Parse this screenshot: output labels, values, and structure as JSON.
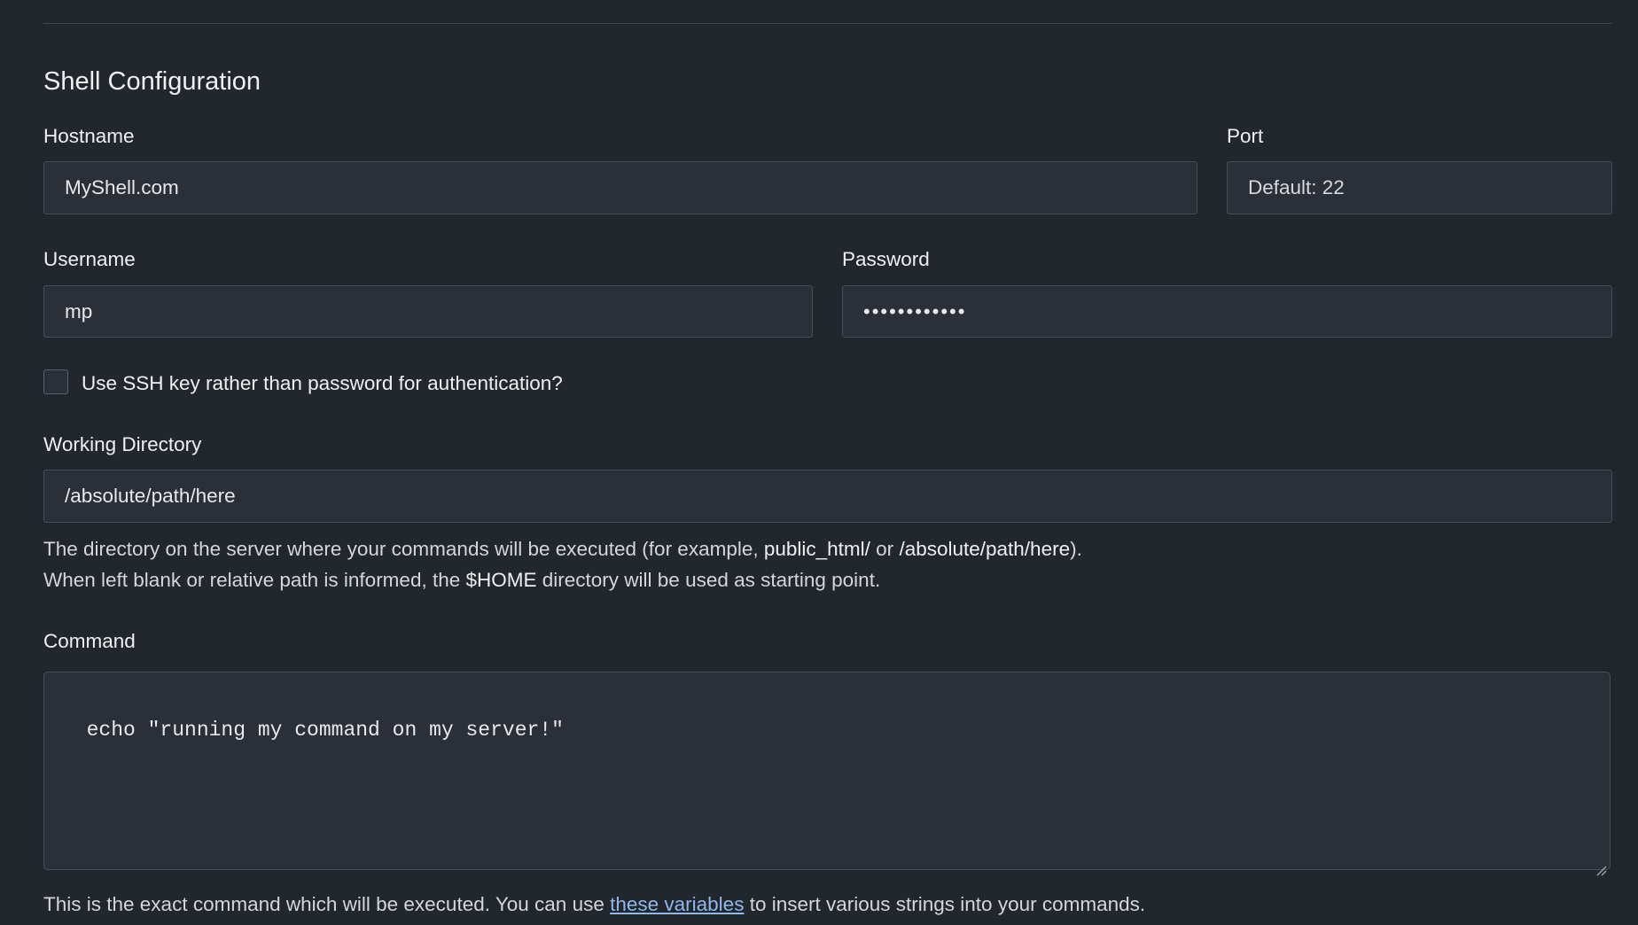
{
  "section": {
    "title": "Shell Configuration"
  },
  "hostname": {
    "label": "Hostname",
    "value": "MyShell.com"
  },
  "port": {
    "label": "Port",
    "placeholder": "Default: 22"
  },
  "username": {
    "label": "Username",
    "value": "mp"
  },
  "password": {
    "label": "Password",
    "masked_value": "••••••••••••"
  },
  "ssh_key": {
    "label": "Use SSH key rather than password for authentication?",
    "checked": false
  },
  "working_directory": {
    "label": "Working Directory",
    "value": "/absolute/path/here",
    "help_line1_before": "The directory on the server where your commands will be executed (for example, ",
    "help_line1_example1": "public_html/",
    "help_line1_or": " or ",
    "help_line1_example2": "/absolute/path/here",
    "help_line1_after": ").",
    "help_line2_before": "When left blank or relative path is informed, the ",
    "help_line2_var": "$HOME",
    "help_line2_after": " directory will be used as starting point."
  },
  "command": {
    "label": "Command",
    "value": "echo \"running my command on my server!\"",
    "help_before": "This is the exact command which will be executed. You can use ",
    "help_link": "these variables",
    "help_after": " to insert various strings into your commands."
  }
}
